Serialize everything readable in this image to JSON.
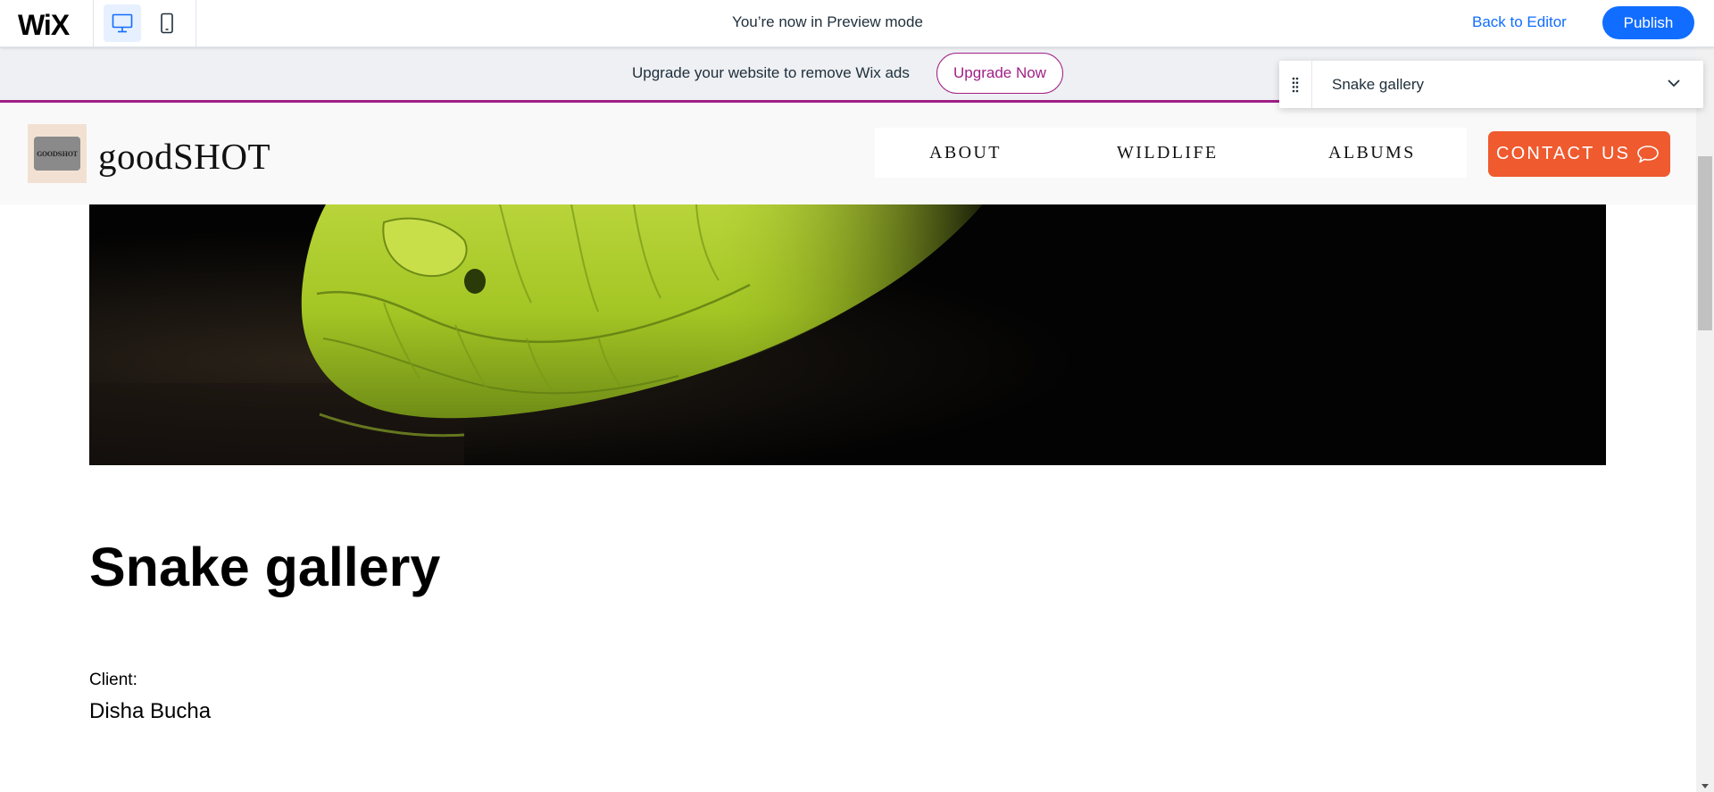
{
  "wix_bar": {
    "logo": "WiX",
    "preview_message": "You’re now in Preview mode",
    "back_to_editor": "Back to Editor",
    "publish": "Publish",
    "devices": [
      "desktop-icon",
      "mobile-icon"
    ]
  },
  "upgrade_banner": {
    "message": "Upgrade your website to remove Wix ads",
    "button": "Upgrade Now",
    "accent": "#a01f86"
  },
  "page_selector": {
    "current_page": "Snake gallery"
  },
  "site_header": {
    "logo_text": "GOODSHOT",
    "brand": "goodSHOT",
    "nav": [
      "ABOUT",
      "WILDLIFE",
      "ALBUMS"
    ],
    "contact": "CONTACT US",
    "contact_color": "#ef5a2f"
  },
  "content": {
    "title": "Snake gallery",
    "client_label": "Client:",
    "client_name": "Disha Bucha"
  },
  "colors": {
    "wix_blue": "#116dff",
    "banner_bg": "#eef0f3"
  }
}
